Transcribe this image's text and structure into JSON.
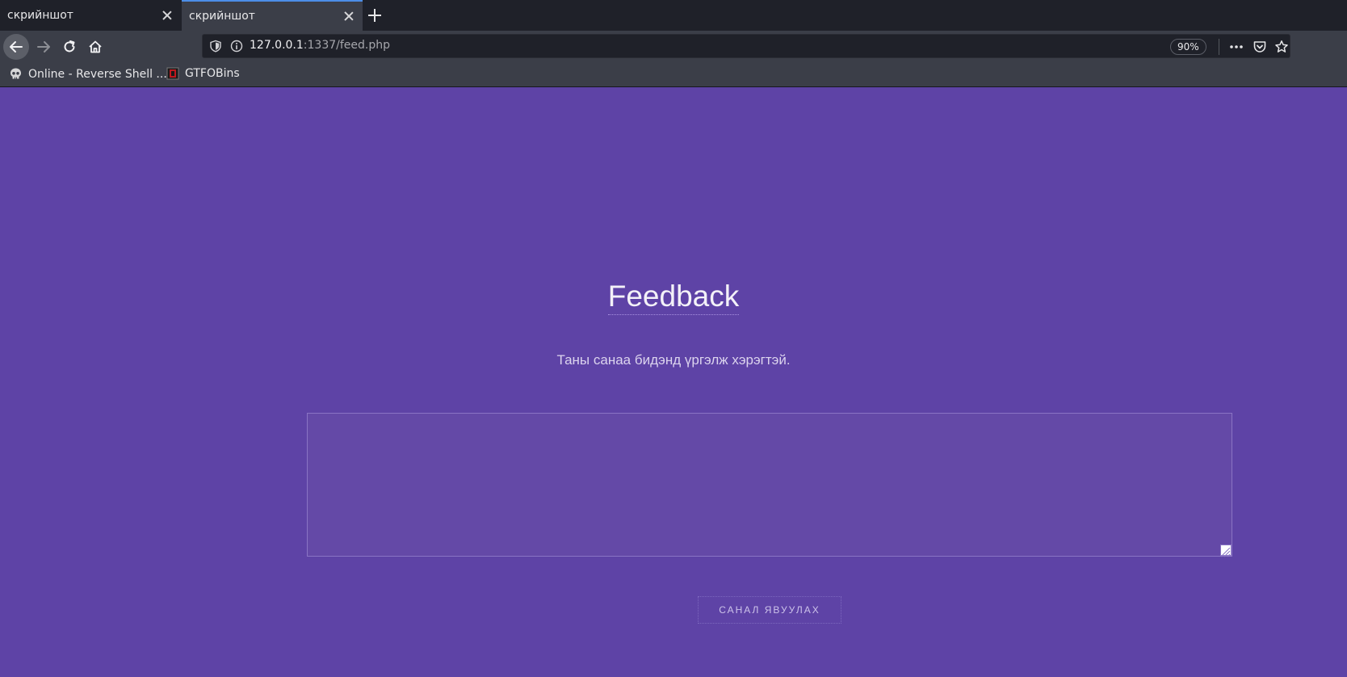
{
  "browser": {
    "tabs": [
      {
        "label": "скрийншот",
        "active": false
      },
      {
        "label": "скрийншот",
        "active": true
      }
    ],
    "url": {
      "host": "127.0.0.1",
      "rest": ":1337/feed.php"
    },
    "zoom": "90%",
    "bookmarks": [
      {
        "label": "Online - Reverse Shell ...",
        "icon": "skull-icon"
      },
      {
        "label": "GTFOBins",
        "icon": "gtfobins-icon"
      }
    ]
  },
  "page": {
    "title": "Feedback",
    "subtitle": "Таны санаа бидэнд үргэлж хэрэгтэй.",
    "textarea_value": "",
    "submit_label": "САНАЛ ЯВУУЛАХ",
    "background_color": "#5e43a6"
  }
}
